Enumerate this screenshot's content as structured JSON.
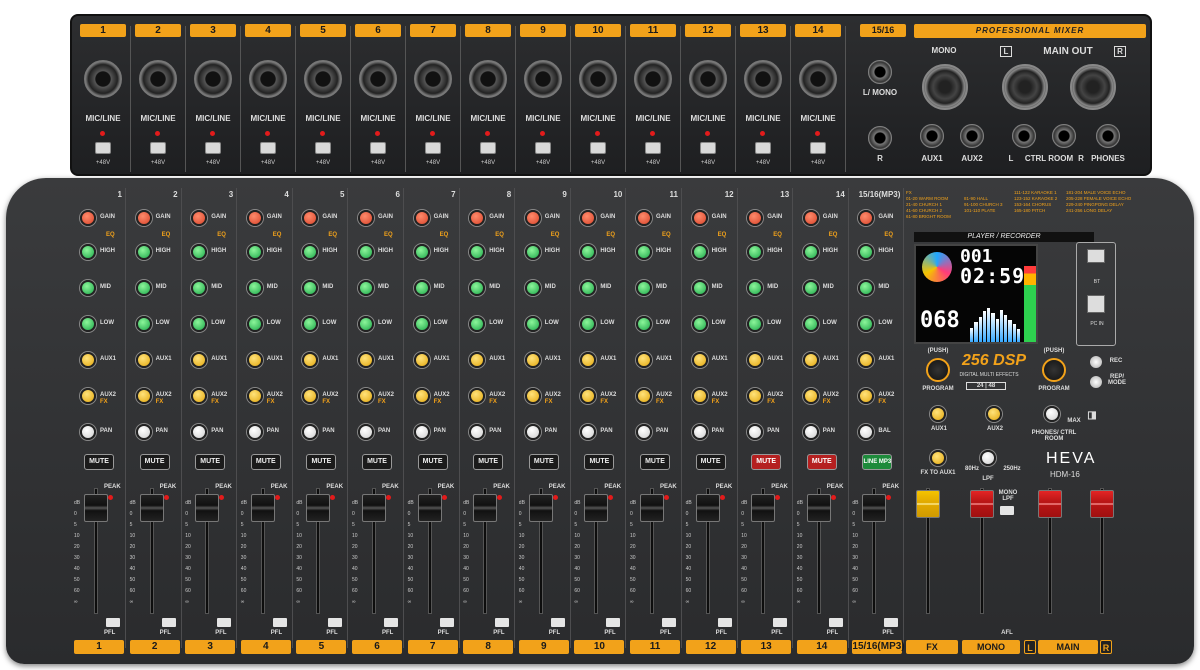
{
  "top_panel": {
    "channels": [
      {
        "num": "1",
        "label": "MIC/LINE",
        "phantom": "+48V"
      },
      {
        "num": "2",
        "label": "MIC/LINE",
        "phantom": "+48V"
      },
      {
        "num": "3",
        "label": "MIC/LINE",
        "phantom": "+48V"
      },
      {
        "num": "4",
        "label": "MIC/LINE",
        "phantom": "+48V"
      },
      {
        "num": "5",
        "label": "MIC/LINE",
        "phantom": "+48V"
      },
      {
        "num": "6",
        "label": "MIC/LINE",
        "phantom": "+48V"
      },
      {
        "num": "7",
        "label": "MIC/LINE",
        "phantom": "+48V"
      },
      {
        "num": "8",
        "label": "MIC/LINE",
        "phantom": "+48V"
      },
      {
        "num": "9",
        "label": "MIC/LINE",
        "phantom": "+48V"
      },
      {
        "num": "10",
        "label": "MIC/LINE",
        "phantom": "+48V"
      },
      {
        "num": "11",
        "label": "MIC/LINE",
        "phantom": "+48V"
      },
      {
        "num": "12",
        "label": "MIC/LINE",
        "phantom": "+48V"
      },
      {
        "num": "13",
        "label": "MIC/LINE",
        "phantom": "+48V"
      },
      {
        "num": "14",
        "label": "MIC/LINE",
        "phantom": "+48V"
      }
    ],
    "stereo_num": "15/16",
    "stereo_l": "L/ MONO",
    "stereo_r": "R",
    "brand_banner": "PROFESSIONAL MIXER",
    "mono": "MONO",
    "main_out": "MAIN OUT",
    "main_l": "L",
    "main_r": "R",
    "aux1": "AUX1",
    "aux2": "AUX2",
    "ctrl_room": "CTRL ROOM",
    "ctrl_l": "L",
    "ctrl_r": "R",
    "phones": "PHONES"
  },
  "channel_strip": {
    "gain": "GAIN",
    "eq": "EQ",
    "high": "HIGH",
    "mid": "MID",
    "low": "LOW",
    "aux1": "AUX1",
    "aux2": "AUX2",
    "fx": "FX",
    "pan": "PAN",
    "bal": "BAL",
    "mute": "MUTE",
    "line_mp3": "LINE MP3",
    "peak": "PEAK",
    "pfl": "PFL",
    "scale": [
      "dB",
      "0",
      "5",
      "10",
      "20",
      "30",
      "40",
      "50",
      "60",
      "∞"
    ]
  },
  "bottom_numbers": [
    "1",
    "2",
    "3",
    "4",
    "5",
    "6",
    "7",
    "8",
    "9",
    "10",
    "11",
    "12",
    "13",
    "14",
    "15/16(MP3)"
  ],
  "red_mute_channels": [
    13,
    14
  ],
  "right_panel": {
    "fx_col1": [
      "FX",
      "01-20 WARM ROOM",
      "21-40 CHURCH 1",
      "41-60 CHURCH 2",
      "61-80 BRIGHT ROOM"
    ],
    "fx_col2": [
      "81-90 HALL",
      "91-100 CHURCH 3",
      "101-110 PLATE"
    ],
    "fx_col3": [
      "111-122 KARAOKE 1",
      "123-152 KARAOKE 2",
      "153-164 CHORUS",
      "165-180 PITCH"
    ],
    "fx_col4": [
      "181-204 MALE VOICE ECHO",
      "205-228 FEMALE VOICE ECHO",
      "229-240 PINGPONG DELAY",
      "241-256 LONG DELAY"
    ],
    "player_title": "PLAYER / RECORDER",
    "lcd_track": "001",
    "lcd_time": "02:59",
    "lcd_program": "068",
    "bt": "BT",
    "pc_in": "PC IN",
    "push_left": "(PUSH)",
    "push_right": "(PUSH)",
    "program_left": "PROGRAM",
    "program_right": "PROGRAM",
    "dsp_big": "256 DSP",
    "dsp_sub": "DIGITAL MULTI EFFECTS",
    "bit": "24 | 48",
    "rec": "REC",
    "rep_mode": "REP/ MODE",
    "aux1": "AUX1",
    "aux2": "AUX2",
    "phones_ctrl": "PHONES/ CTRL ROOM",
    "max": "MAX",
    "fx_to_aux1": "FX TO AUX1",
    "lpf_low": "80Hz",
    "lpf_high": "250Hz",
    "lpf": "LPF",
    "mono_lpf": "MONO LPF",
    "afl": "AFL",
    "brand": "HEVA",
    "model": "HDM-16",
    "sect_fx": "FX",
    "sect_mono": "MONO",
    "sect_main": "MAIN",
    "sect_main_l": "L",
    "sect_main_r": "R"
  },
  "colors": {
    "accent": "#f2a21a",
    "gain_knob": "#d8452b",
    "eq_knob": "#1ea84a",
    "aux_knob": "#e3a80f",
    "mute_red": "#b52020"
  }
}
